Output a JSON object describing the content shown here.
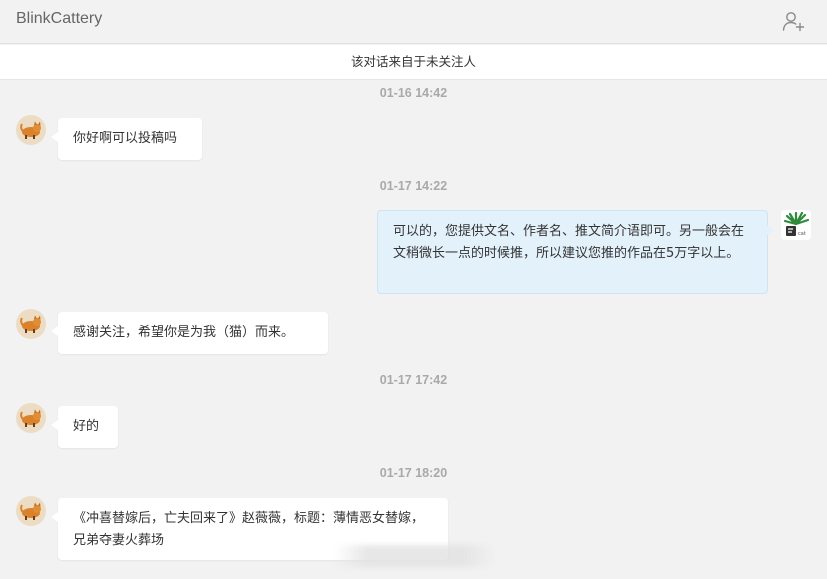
{
  "header": {
    "title": "BlinkCattery",
    "add_contact_icon": "add-user-icon"
  },
  "notice": "该对话来自于未关注人",
  "messages": [
    {
      "timestamp": "01-16 14:42",
      "side": "left",
      "avatar": "cat-avatar",
      "text": "你好啊可以投稿吗"
    },
    {
      "timestamp": "01-17 14:22",
      "side": "right",
      "avatar": "plant-avatar",
      "text": "可以的，您提供文名、作者名、推文简介语即可。另一般会在文稍微长一点的时候推，所以建议您推的作品在5万字以上。"
    },
    {
      "timestamp": "",
      "side": "left",
      "avatar": "cat-avatar",
      "text": "感谢关注，希望你是为我（猫）而来。"
    },
    {
      "timestamp": "01-17 17:42",
      "side": "left",
      "avatar": "cat-avatar",
      "text": "好的"
    },
    {
      "timestamp": "01-17 18:20",
      "side": "left",
      "avatar": "cat-avatar",
      "text": "《冲喜替嫁后，亡夫回来了》赵薇薇，标题：薄情恶女替嫁，兄弟夺妻火葬场"
    }
  ],
  "colors": {
    "background": "#f2f2f2",
    "incoming_bubble": "#ffffff",
    "outgoing_bubble": "#e3f1fb",
    "timestamp": "#a9a9a9"
  }
}
